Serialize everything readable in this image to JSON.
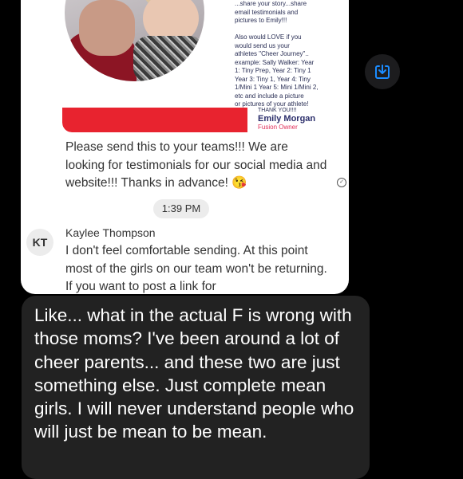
{
  "flyer": {
    "text": "...share your story...share\nemail testimonials and\npictures to Emily!!!\n\nAlso would LOVE if you\nwould send us your\nathletes \"Cheer Journey\"..\nexample: Sally Walker: Year\n1: Tiny Prep, Year 2: Tiny 1\nYear 3: Tiny 1, Year 4: Tiny\n1/Mini 1 Year 5: Mini 1/Mini 2,\netc and include a picture\nor pictures of your athlete!",
    "thanks": "THANK YOU!!!!",
    "name": "Emily Morgan",
    "role": "Fusion Owner"
  },
  "message": {
    "body": "Please send this to your teams!!! We are looking for testimonials for our social media and website!!! Thanks in advance! 😘",
    "status_icon": "sent-check-icon"
  },
  "timestamp": "1:39 PM",
  "reply": {
    "avatar_initials": "KT",
    "sender": "Kaylee Thompson",
    "text": "I don't feel comfortable sending. At this point most of the girls on our team won't be returning. If you want to post a link for"
  },
  "download_icon": "download-icon",
  "caption": {
    "text": "Like... what in the actual F is wrong with those moms? I've been around a lot of cheer parents... and these two are just something else. Just complete mean girls. I will never understand people who will just be mean to be mean."
  }
}
